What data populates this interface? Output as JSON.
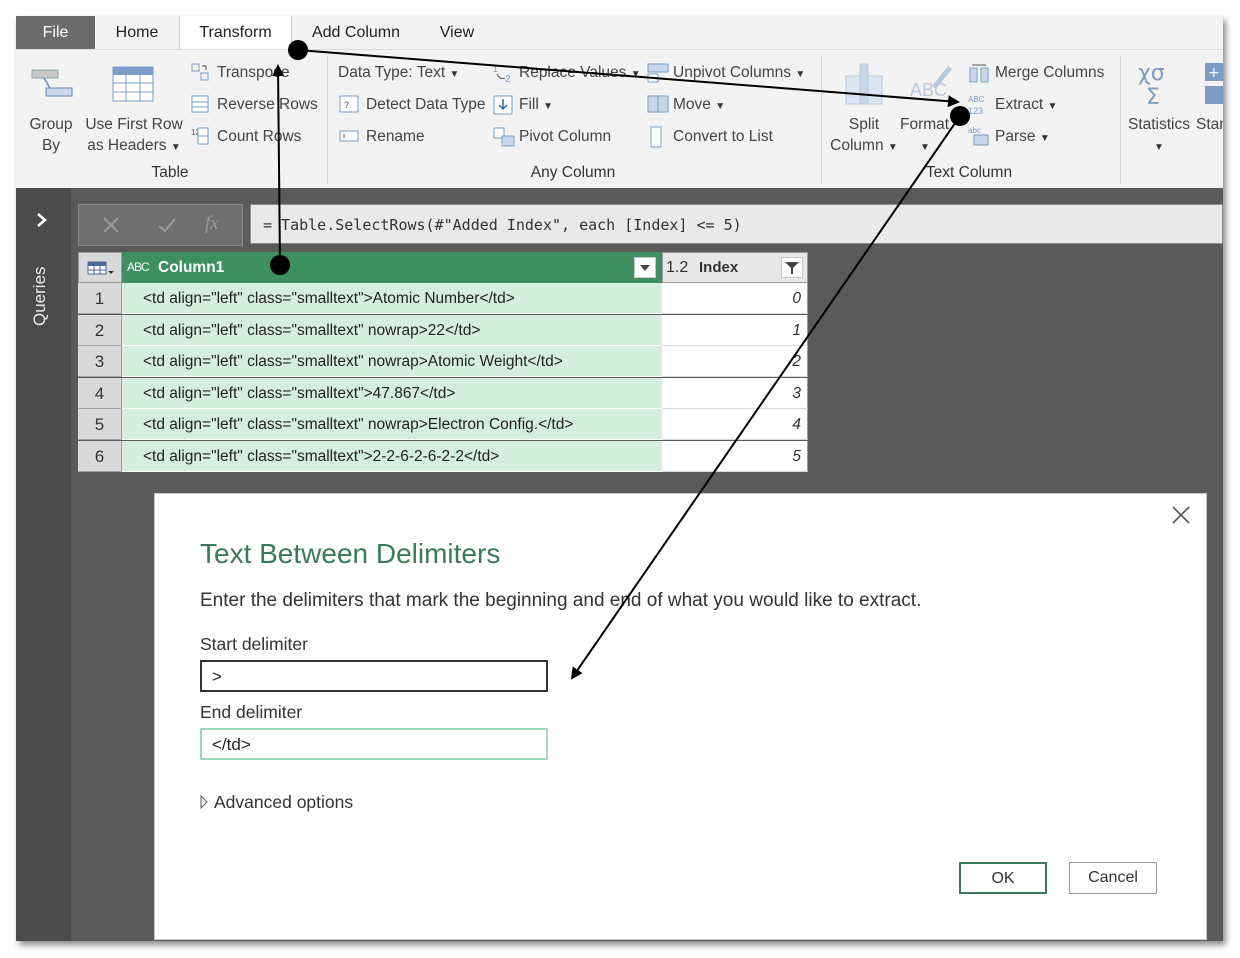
{
  "tabs": {
    "file": "File",
    "home": "Home",
    "transform": "Transform",
    "add_column": "Add Column",
    "view": "View"
  },
  "ribbon": {
    "table": {
      "title": "Table",
      "group_by_l1": "Group",
      "group_by_l2": "By",
      "first_row_l1": "Use First Row",
      "first_row_l2": "as Headers",
      "transpose": "Transpose",
      "reverse_rows": "Reverse Rows",
      "count_rows": "Count Rows"
    },
    "any_column": {
      "title": "Any Column",
      "data_type": "Data Type: Text",
      "detect_type": "Detect Data Type",
      "rename": "Rename",
      "replace_values": "Replace Values",
      "fill": "Fill",
      "pivot": "Pivot Column",
      "unpivot": "Unpivot Columns",
      "move": "Move",
      "convert_list": "Convert to List"
    },
    "text_column": {
      "title": "Text Column",
      "split_l1": "Split",
      "split_l2": "Column",
      "format": "Format",
      "merge": "Merge Columns",
      "extract": "Extract",
      "parse": "Parse"
    },
    "number_column": {
      "statistics": "Statistics",
      "standard": "Stan"
    }
  },
  "left_rail": {
    "queries": "Queries"
  },
  "formula_bar": {
    "fx": "fx",
    "formula": "= Table.SelectRows(#\"Added Index\", each [Index] <= 5)"
  },
  "grid": {
    "column1_type": "ABC",
    "column1_header": "Column1",
    "index_type": "1.2",
    "index_header": "Index",
    "rows": [
      {
        "n": "1",
        "col1": "<td align=\"left\" class=\"smalltext\">Atomic Number</td>",
        "index": "0"
      },
      {
        "n": "2",
        "col1": "<td align=\"left\" class=\"smalltext\" nowrap>22</td>",
        "index": "1"
      },
      {
        "n": "3",
        "col1": "<td align=\"left\" class=\"smalltext\" nowrap>Atomic Weight</td>",
        "index": "2"
      },
      {
        "n": "4",
        "col1": "<td align=\"left\" class=\"smalltext\">47.867</td>",
        "index": "3"
      },
      {
        "n": "5",
        "col1": "<td align=\"left\" class=\"smalltext\" nowrap>Electron Config.</td>",
        "index": "4"
      },
      {
        "n": "6",
        "col1": "<td align=\"left\" class=\"smalltext\">2-2-6-2-6-2-2</td>",
        "index": "5"
      }
    ]
  },
  "dialog": {
    "title": "Text Between Delimiters",
    "description": "Enter the delimiters that mark the beginning and end of what you would like to extract.",
    "start_label": "Start delimiter",
    "start_value": ">",
    "end_label": "End delimiter",
    "end_value": "</td>",
    "advanced": "Advanced options",
    "ok": "OK",
    "cancel": "Cancel"
  },
  "colors": {
    "accent_green": "#3d8f5f",
    "row_green": "#d6eedf",
    "title_green": "#3a7a5a",
    "frame_dark": "#5a5a5a"
  }
}
